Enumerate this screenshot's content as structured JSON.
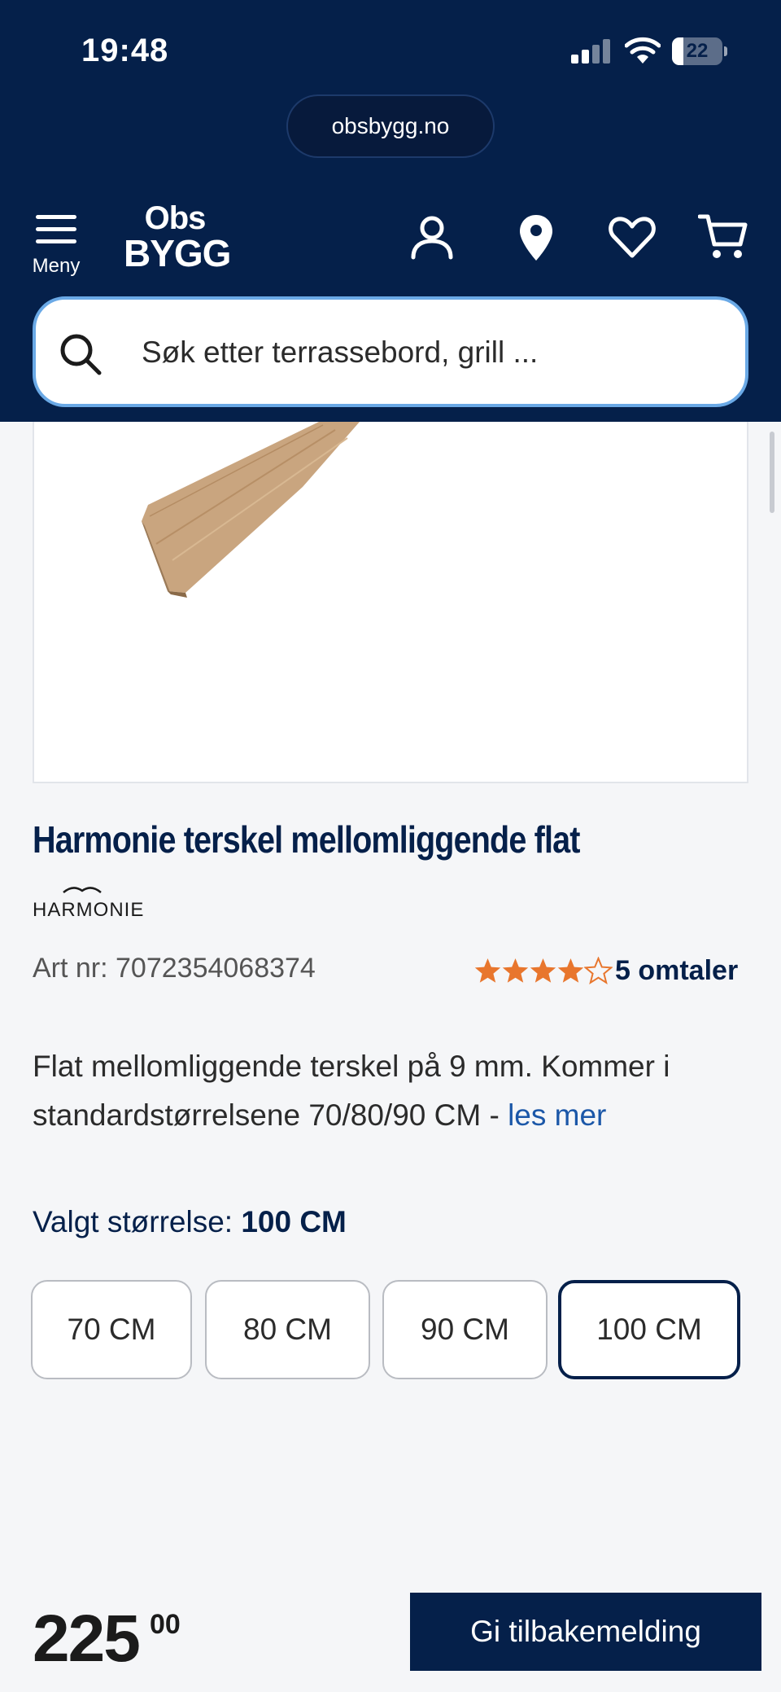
{
  "status_bar": {
    "time": "19:48",
    "battery": "22"
  },
  "browser": {
    "url": "obsbygg.no"
  },
  "header": {
    "menu_label": "Meny",
    "logo_line1": "Obs",
    "logo_line2": "BYGG",
    "search_placeholder": "Søk etter terrassebord, grill ..."
  },
  "product": {
    "title": "Harmonie terskel mellomliggende flat",
    "brand": "HARMONIE",
    "art_nr": "Art nr: 7072354068374",
    "rating": 4,
    "rating_max": 5,
    "reviews": "5 omtaler",
    "description": "Flat mellomliggende terskel på 9 mm. Kommer i standardstørrelsene 70/80/90 CM -",
    "read_more": "les mer",
    "size_label": "Valgt størrelse:",
    "selected_size": "100 CM",
    "sizes": [
      "70 CM",
      "80 CM",
      "90 CM",
      "100 CM"
    ],
    "price_main": "225",
    "price_decimals": "00"
  },
  "feedback_button": "Gi tilbakemelding",
  "colors": {
    "brand_navy": "#05204a",
    "star_orange": "#e8762d",
    "link_blue": "#1b57a8",
    "search_border": "#6aa9e6"
  }
}
